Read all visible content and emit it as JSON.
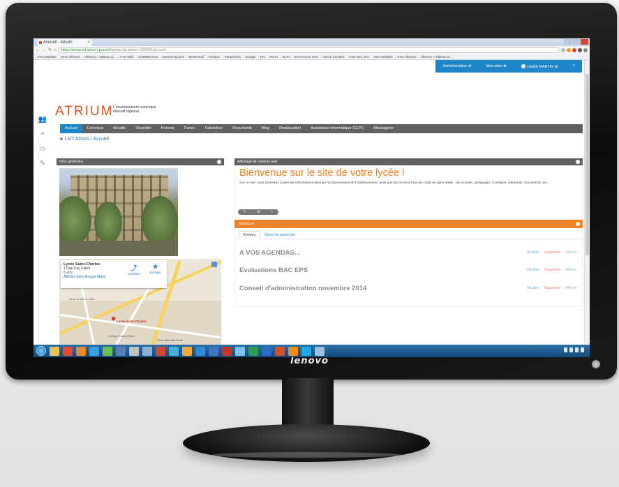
{
  "monitor": {
    "brand": "lenovo"
  },
  "browser": {
    "tab_title": "Accueil - Atrium",
    "url_secure": "https://preprod.atrium-paca.fr",
    "url_path": "/group/lgt-atrium-130061/accueil",
    "bookmarks": [
      "STG-Webdev",
      "STG-Alfresco",
      "Alfresco » Tableau d...",
      "STG-Wiki",
      "CORRECTCS",
      "Extranet lycées",
      "MonPortail",
      "Freebox",
      "Paramètres",
      "Google",
      "Pro",
      "Perso",
      "GLPI",
      "STG-Forum STG",
      "Atrium (recette)",
      "STG-Get_Tice",
      "STG-Webdev",
      "STG-Alfresco",
      "Alfresco » Tableau d..."
    ]
  },
  "admin_bar": {
    "administration": "Administration",
    "mes_sites": "Mes sites",
    "user": "cheikh MARTIN",
    "help": "?"
  },
  "logo": {
    "name": "ATRIUM",
    "line1": "L'environnement numérique",
    "line2": "éducatif régional"
  },
  "nav": [
    "Accueil",
    "Correlyce",
    "Moodle",
    "Charlotte",
    "Pronote",
    "Forum",
    "Calendrier",
    "Documents",
    "Blog",
    "Restauration",
    "Assistance informatique (GLPI)",
    "Messagerie"
  ],
  "breadcrumb": "LGT Atrium / Accueil",
  "left_portlet": {
    "title": "Infos générales",
    "map": {
      "place_name": "Lycée Saint-Charles",
      "address": "1 Rue Guy Fabre",
      "rating": "3 avis",
      "larger_map": "Afficher dans Google Maps",
      "directions": "Itinéraire",
      "save": "Enregis",
      "pin_label": "Lycée Saint-Charles",
      "label1": "Toute la ville en vélo",
      "label2": "Collège Camus Paris",
      "label3": "Perle Marseille Hotel"
    }
  },
  "welcome": {
    "header": "Affichage de contenu web",
    "title": "Bienvenue sur le site de votre lycée !",
    "text": "Sur ce site, vous trouverez toutes les informations liées au fonctionnement de l'établissement, ainsi que les accès à tous les outils en ligne utiles : vie scolaire, pédagogie, Correlyce, calendrier, documents, etc..."
  },
  "annonces": {
    "header": "Annonces",
    "tabs": [
      "Entrées",
      "Gérer les annonces"
    ],
    "items": [
      {
        "title": "A VOS AGENDAS..."
      },
      {
        "title": "Evaluations BAC EPS"
      },
      {
        "title": "Conseil d'administration novembre 2014"
      }
    ],
    "modify": "Modifier",
    "delete": "Supprimer",
    "show": "Afficher"
  },
  "colors": {
    "accent_blue": "#1f86c9",
    "accent_orange": "#f0832a",
    "logo_orange": "#e2531c",
    "nav_gray": "#616161"
  }
}
